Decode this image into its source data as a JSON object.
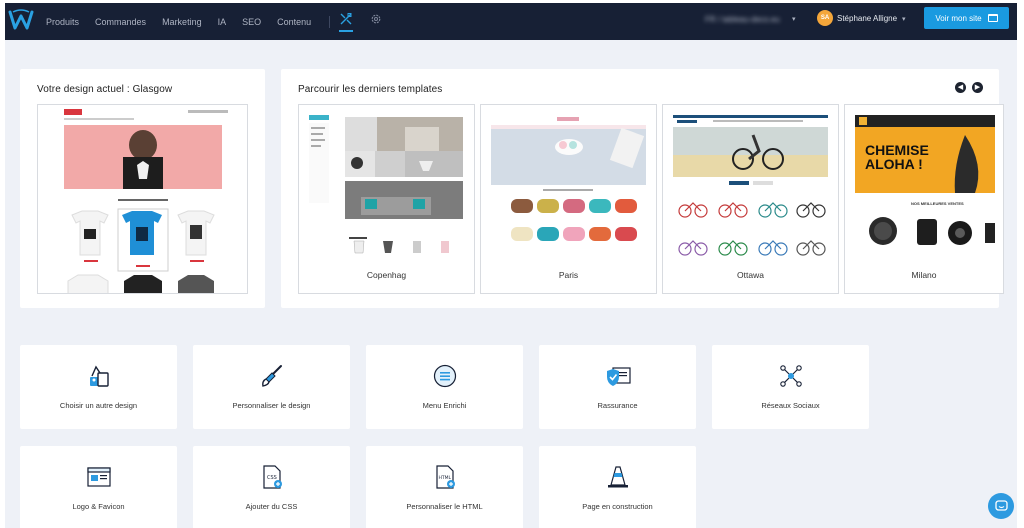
{
  "nav": {
    "items": [
      "Produits",
      "Commandes",
      "Marketing",
      "IA",
      "SEO",
      "Contenu"
    ]
  },
  "topbar": {
    "shop_name": "FR / tableau-deco.eu",
    "user_initials": "SA",
    "user_name": "Stéphane Alligne",
    "cta_label": "Voir mon site"
  },
  "current_design": {
    "title": "Votre design actuel : Glasgow"
  },
  "templates": {
    "title": "Parcourir les derniers templates",
    "items": [
      {
        "name": "Copenhag"
      },
      {
        "name": "Paris"
      },
      {
        "name": "Ottawa"
      },
      {
        "name": "Milano",
        "promo_line1": "CHEMISE",
        "promo_line2": "ALOHA !",
        "best_label": "NOS MEILLEURES VENTES"
      }
    ]
  },
  "actions": [
    {
      "label": "Choisir un autre design",
      "icon": "paint-bucket-icon"
    },
    {
      "label": "Personnaliser le design",
      "icon": "paintbrush-icon"
    },
    {
      "label": "Menu Enrichi",
      "icon": "menu-list-icon"
    },
    {
      "label": "Rassurance",
      "icon": "shield-check-icon"
    },
    {
      "label": "Réseaux Sociaux",
      "icon": "network-icon"
    },
    {
      "label": "Logo & Favicon",
      "icon": "browser-window-icon"
    },
    {
      "label": "Ajouter du CSS",
      "icon": "css-file-icon"
    },
    {
      "label": "Personnaliser le HTML",
      "icon": "html-file-icon"
    },
    {
      "label": "Page en construction",
      "icon": "traffic-cone-icon"
    }
  ],
  "colors": {
    "topbar": "#172035",
    "accent": "#1a9ae0",
    "background": "#eef1f7"
  }
}
